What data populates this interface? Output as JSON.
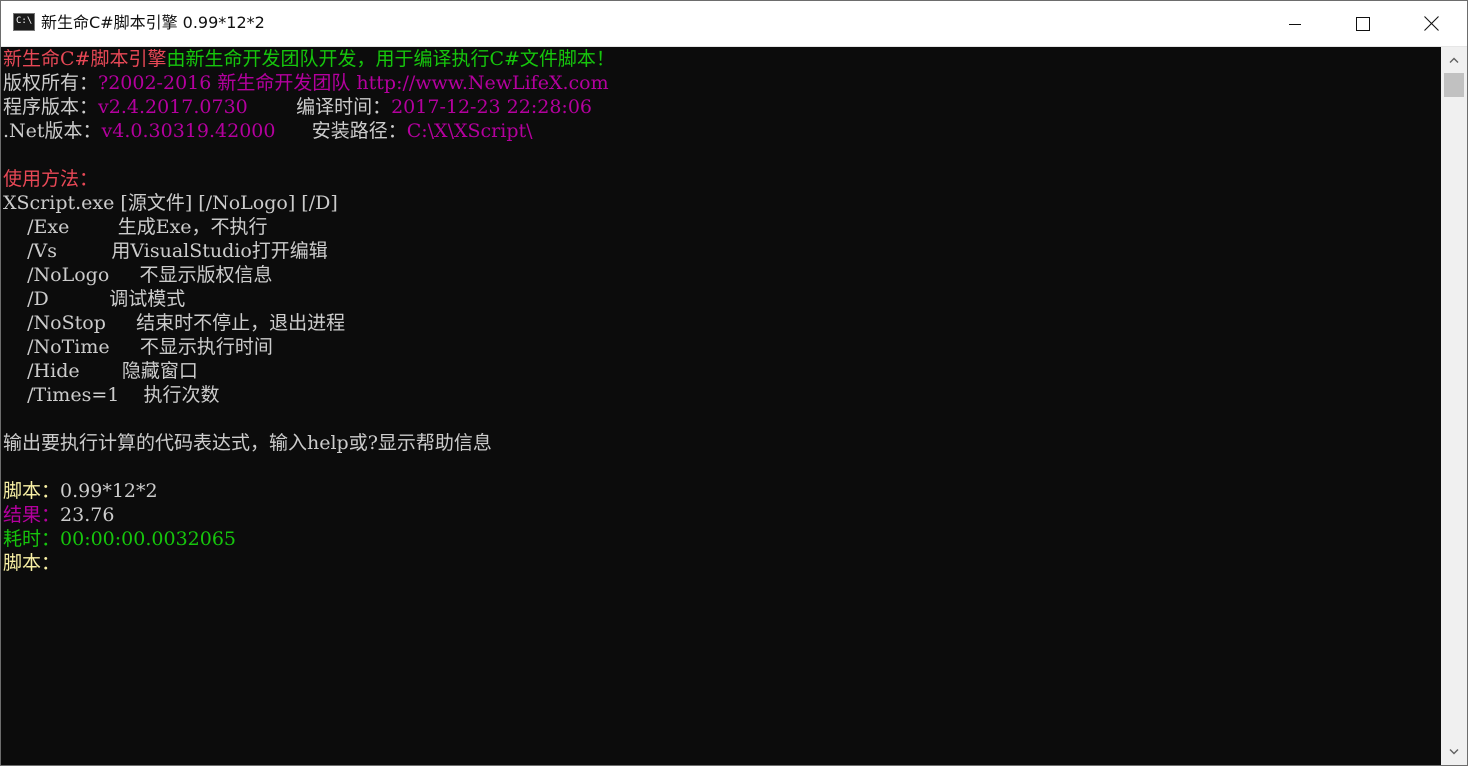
{
  "window": {
    "title": "新生命C#脚本引擎 0.99*12*2",
    "icon": "cmd-console-icon",
    "icon_text": "C:\\"
  },
  "console": {
    "lines": [
      [
        {
          "text": "新生命C#脚本引擎",
          "color": "red"
        },
        {
          "text": "由新生命开发团队开发，用于编译执行C#文件脚本！",
          "color": "green"
        }
      ],
      [
        {
          "text": "版权所有：",
          "color": "gray"
        },
        {
          "text": "?2002-2016 新生命开发团队 http://www.NewLifeX.com",
          "color": "magenta"
        }
      ],
      [
        {
          "text": "程序版本：",
          "color": "gray"
        },
        {
          "text": "v2.4.2017.0730        ",
          "color": "magenta"
        },
        {
          "text": "编译时间：",
          "color": "gray"
        },
        {
          "text": "2017-12-23 22:28:06",
          "color": "magenta"
        }
      ],
      [
        {
          "text": ".Net版本：",
          "color": "gray"
        },
        {
          "text": "v4.0.30319.42000      ",
          "color": "magenta"
        },
        {
          "text": "安装路径：",
          "color": "gray"
        },
        {
          "text": "C:\\X\\XScript\\",
          "color": "magenta"
        }
      ],
      [],
      [
        {
          "text": "使用方法：",
          "color": "red"
        }
      ],
      [
        {
          "text": "XScript.exe [源文件] [/NoLogo] [/D]",
          "color": "gray"
        }
      ],
      [
        {
          "text": "    /Exe        生成Exe，不执行",
          "color": "gray"
        }
      ],
      [
        {
          "text": "    /Vs         用VisualStudio打开编辑",
          "color": "gray"
        }
      ],
      [
        {
          "text": "    /NoLogo     不显示版权信息",
          "color": "gray"
        }
      ],
      [
        {
          "text": "    /D          调试模式",
          "color": "gray"
        }
      ],
      [
        {
          "text": "    /NoStop     结束时不停止，退出进程",
          "color": "gray"
        }
      ],
      [
        {
          "text": "    /NoTime     不显示执行时间",
          "color": "gray"
        }
      ],
      [
        {
          "text": "    /Hide       隐藏窗口",
          "color": "gray"
        }
      ],
      [
        {
          "text": "    /Times=1    执行次数",
          "color": "gray"
        }
      ],
      [],
      [
        {
          "text": "输出要执行计算的代码表达式，输入help或?显示帮助信息",
          "color": "gray"
        }
      ],
      [],
      [
        {
          "text": "脚本：",
          "color": "yellow"
        },
        {
          "text": "0.99*12*2",
          "color": "gray"
        }
      ],
      [
        {
          "text": "结果：",
          "color": "magenta"
        },
        {
          "text": "23.76",
          "color": "gray"
        }
      ],
      [
        {
          "text": "耗时：",
          "color": "green"
        },
        {
          "text": "00:00:00.0032065",
          "color": "green"
        }
      ],
      [
        {
          "text": "脚本：",
          "color": "yellow"
        }
      ]
    ]
  },
  "colors": {
    "red": "#e74856",
    "green": "#16c60c",
    "magenta": "#b4009e",
    "gray": "#cccccc",
    "yellow": "#f9f1a5",
    "background": "#0c0c0c"
  },
  "controls": {
    "minimize_icon": "minimize-icon",
    "maximize_icon": "maximize-icon",
    "close_icon": "close-icon",
    "scroll_up_icon": "chevron-up-icon",
    "scroll_down_icon": "chevron-down-icon"
  }
}
